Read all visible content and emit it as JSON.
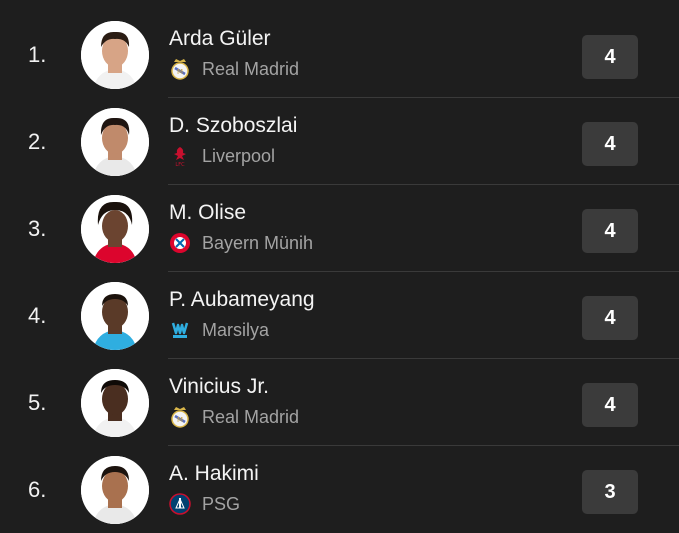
{
  "players": [
    {
      "rank": "1.",
      "name": "Arda Güler",
      "team": "Real Madrid",
      "team_icon": "real-madrid-crest-icon",
      "score": "4"
    },
    {
      "rank": "2.",
      "name": "D. Szoboszlai",
      "team": "Liverpool",
      "team_icon": "liverpool-crest-icon",
      "score": "4"
    },
    {
      "rank": "3.",
      "name": "M. Olise",
      "team": "Bayern Münih",
      "team_icon": "bayern-crest-icon",
      "score": "4"
    },
    {
      "rank": "4.",
      "name": "P. Aubameyang",
      "team": "Marsilya",
      "team_icon": "marseille-crest-icon",
      "score": "4"
    },
    {
      "rank": "5.",
      "name": "Vinicius Jr.",
      "team": "Real Madrid",
      "team_icon": "real-madrid-crest-icon",
      "score": "4"
    },
    {
      "rank": "6.",
      "name": "A. Hakimi",
      "team": "PSG",
      "team_icon": "psg-crest-icon",
      "score": "3"
    }
  ],
  "colors": {
    "background": "#1e1e1e",
    "score_badge": "#3b3b3b",
    "divider": "#3a3a3a",
    "secondary_text": "#a3a3a3",
    "skin_tones": [
      "#d7a486",
      "#c08a6b",
      "#6b4430",
      "#5a3a28",
      "#4a2e20",
      "#a9714f"
    ]
  }
}
